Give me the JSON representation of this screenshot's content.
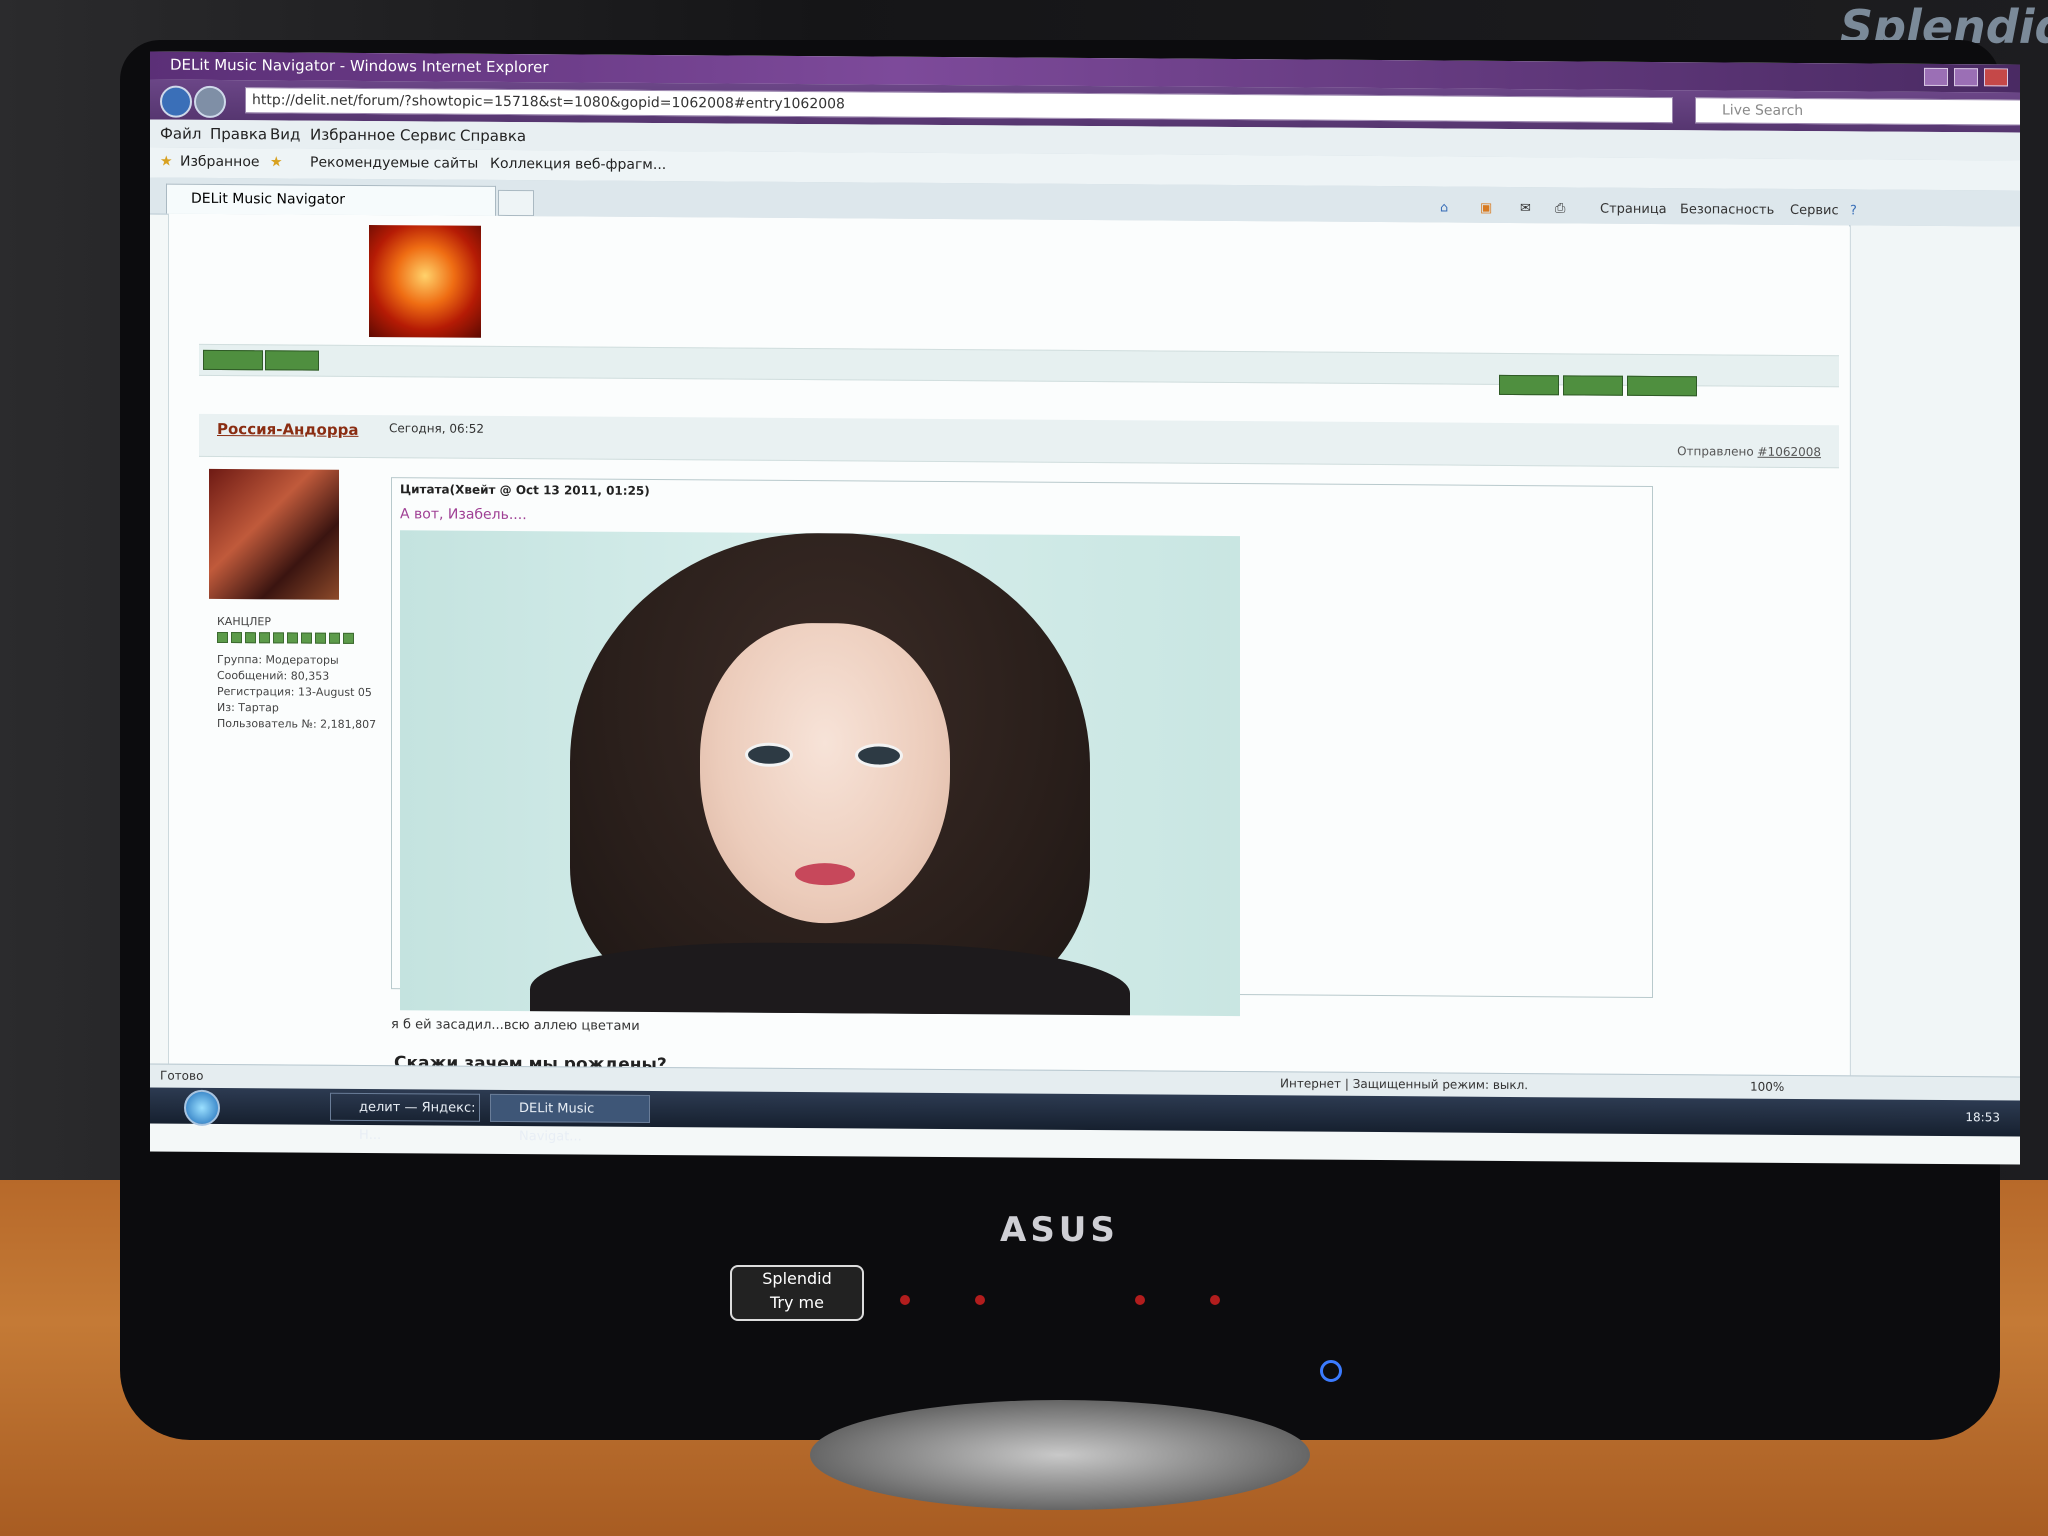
{
  "window": {
    "title": "DELit Music Navigator - Windows Internet Explorer",
    "address": "http://delit.net/forum/?showtopic=15718&st=1080&gopid=1062008#entry1062008",
    "search_placeholder": "Live Search"
  },
  "menu": {
    "items": [
      "Файл",
      "Правка",
      "Вид",
      "Избранное",
      "Сервис",
      "Справка"
    ]
  },
  "favorites": {
    "favorites_label": "Избранное",
    "suggested_sites": "Рекомендуемые сайты",
    "web_slices": "Коллекция веб-фрагм..."
  },
  "tab": {
    "label": "DELit Music Navigator"
  },
  "command_bar": {
    "page": "Страница",
    "safety": "Безопасность",
    "tools": "Сервис"
  },
  "post": {
    "author": "Россия-Андорра",
    "date": "Сегодня, 06:52",
    "sent_label": "Отправлено",
    "sent_id": "#1062008",
    "rank": "КАНЦЛЕР",
    "info": [
      "Группа: Модераторы",
      "Сообщений: 80,353",
      "Регистрация: 13-August 05",
      "Из: Тартар",
      "Пользователь №: 2,181,807"
    ],
    "quote_header": "Цитата(Хвейт @ Oct 13 2011, 01:25)",
    "quote_text": "А вот, Изабель....",
    "body": "я б ей засадил...всю аллею цветами",
    "signature": "Скажи зачем мы рождены?"
  },
  "status": {
    "ready": "Готово",
    "zone": "Интернет | Защищенный режим: выкл.",
    "zoom": "100%"
  },
  "taskbar": {
    "items": [
      "делит — Яндекс: Н...",
      "DELit Music Navigat..."
    ],
    "clock": "18:53"
  },
  "monitor": {
    "brand": "ASUS",
    "splendid": "Splendid",
    "try_me": "Try me"
  },
  "colors": {
    "title_bar": "#5b2f77",
    "author": "#8a2d12",
    "quote_text": "#9f3f94",
    "button_green": "#4f8f3f"
  }
}
